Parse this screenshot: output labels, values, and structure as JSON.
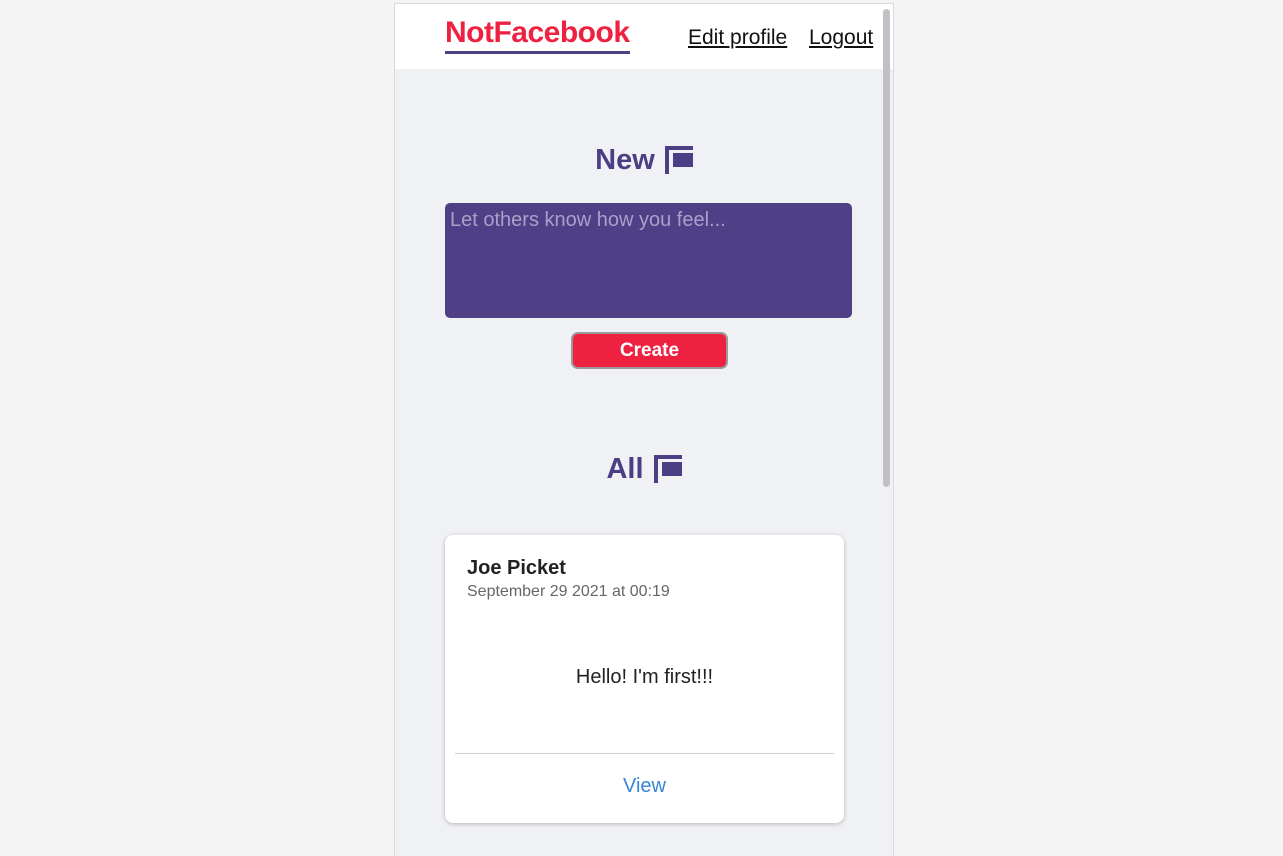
{
  "header": {
    "logo": "NotFacebook",
    "nav": {
      "edit_profile": "Edit profile",
      "logout": "Logout"
    }
  },
  "new_section": {
    "title": "New",
    "icon": "flag-icon",
    "input_placeholder": "Let others know how you feel...",
    "input_value": "",
    "create_label": "Create"
  },
  "all_section": {
    "title": "All",
    "icon": "flag-icon",
    "posts": [
      {
        "author": "Joe Picket",
        "timestamp": "September 29 2021 at 00:19",
        "body": "Hello! I'm first!!!",
        "view_label": "View"
      }
    ]
  },
  "colors": {
    "brand_red": "#ef2140",
    "brand_purple": "#4f3f87",
    "link_blue": "#3a86d4",
    "page_background": "#f0f1f4"
  }
}
